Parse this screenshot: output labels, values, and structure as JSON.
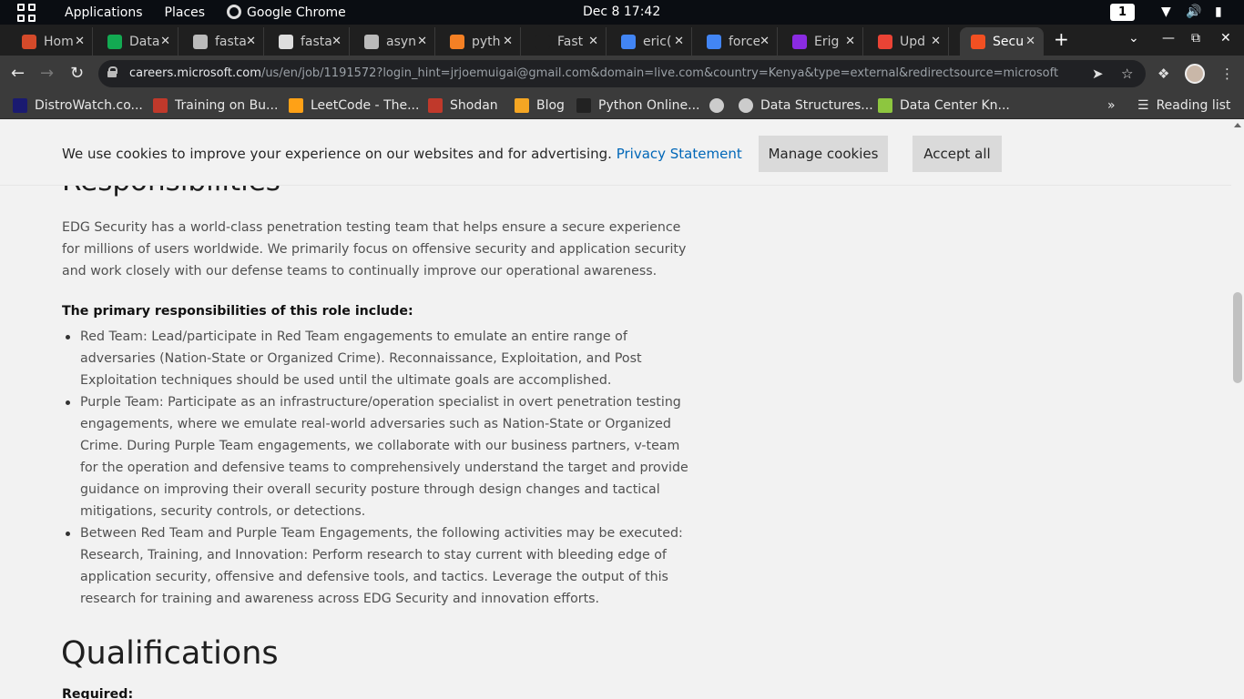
{
  "system_bar": {
    "applications": "Applications",
    "places": "Places",
    "active_app": "Google Chrome",
    "clock": "Dec 8  17:42",
    "workspace": "1",
    "icons": [
      "wifi-icon",
      "volume-icon",
      "battery-icon"
    ]
  },
  "tabs": [
    {
      "title": "Hom",
      "icon": "favicon-red",
      "color": "#d44a2a"
    },
    {
      "title": "Data",
      "icon": "favicon-mongo-leaf",
      "color": "#13aa52"
    },
    {
      "title": "fasta",
      "icon": "github-icon",
      "color": "#bbbbbb"
    },
    {
      "title": "fasta",
      "icon": "favicon-circle",
      "color": "#dddddd"
    },
    {
      "title": "asyn",
      "icon": "github-icon",
      "color": "#bbbbbb"
    },
    {
      "title": "pyth",
      "icon": "stackoverflow-icon",
      "color": "#f48024"
    },
    {
      "title": "Fast",
      "icon": "favicon-blank",
      "color": "#1f1f1f"
    },
    {
      "title": "eric(",
      "icon": "google-icon",
      "color": "#4285f4"
    },
    {
      "title": "force",
      "icon": "google-icon",
      "color": "#4285f4"
    },
    {
      "title": "Erig",
      "icon": "favicon-purple",
      "color": "#8a2be2"
    },
    {
      "title": "Upd",
      "icon": "gmail-icon",
      "color": "#ea4335"
    },
    {
      "title": "Secu",
      "icon": "microsoft-icon",
      "color": "#f25022",
      "active": true
    }
  ],
  "address_bar": {
    "host": "careers.microsoft.com",
    "path": "/us/en/job/1191572?login_hint=jrjoemuigai@gmail.com&domain=live.com&country=Kenya&type=external&redirectsource=microsoft"
  },
  "bookmarks": [
    {
      "label": "DistroWatch.co...",
      "icon": "distrowatch-icon",
      "color": "#1a1a70"
    },
    {
      "label": "Training on Bu...",
      "icon": "training-icon",
      "color": "#c0392b"
    },
    {
      "label": "LeetCode - The...",
      "icon": "leetcode-icon",
      "color": "#ffa116"
    },
    {
      "label": "Shodan",
      "icon": "shodan-icon",
      "color": "#c0392b"
    },
    {
      "label": "Blog",
      "icon": "blog-icon",
      "color": "#f5a623"
    },
    {
      "label": "Python Online...",
      "icon": "python-online-icon",
      "color": "#222222"
    },
    {
      "label": "",
      "icon": "globe-icon",
      "color": "#cccccc"
    },
    {
      "label": "Data Structures...",
      "icon": "globe-icon",
      "color": "#cccccc"
    },
    {
      "label": "Data Center Kn...",
      "icon": "dck-icon",
      "color": "#8dc63f"
    }
  ],
  "reading_list": "Reading list",
  "cookie_banner": {
    "message": "We use cookies to improve your experience on our websites and for advertising.",
    "privacy_link": "Privacy Statement",
    "manage": "Manage cookies",
    "accept": "Accept all"
  },
  "job": {
    "responsibilities_heading": "Responsibilities",
    "intro": "EDG Security has a world-class penetration testing team that helps ensure a secure experience for millions of users worldwide. We primarily focus on offensive security and application security and work closely with our defense teams to continually improve our operational awareness.",
    "list_heading": "The primary responsibilities of this role include:",
    "items": [
      "Red Team: Lead/participate in Red Team engagements to emulate an entire range of adversaries (Nation-State or Organized Crime). Reconnaissance, Exploitation, and Post Exploitation techniques should be used until the ultimate goals are accomplished.",
      "Purple Team: Participate as an infrastructure/operation specialist in overt penetration testing engagements, where we emulate real-world adversaries such as Nation-State or Organized Crime. During Purple Team engagements, we collaborate with our business partners, v-team for the operation and defensive teams to comprehensively understand the target and provide guidance on improving their overall security posture through design changes and tactical mitigations, security controls, or detections.",
      "Between Red Team and Purple Team Engagements, the following activities may be executed: Research, Training, and Innovation: Perform research to stay current with bleeding edge of application security, offensive and defensive tools, and tactics. Leverage the output of this research for training and awareness across EDG Security and innovation efforts."
    ],
    "qualifications_heading": "Qualifications",
    "required_label": "Required:"
  }
}
